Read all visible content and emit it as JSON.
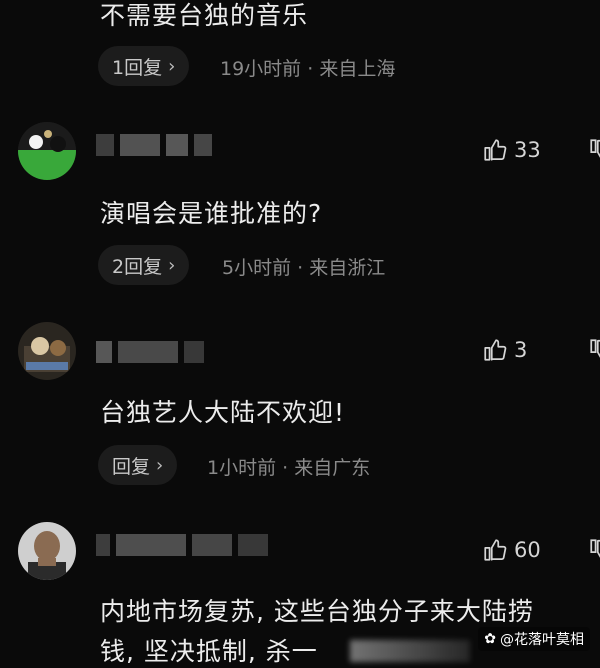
{
  "comments": [
    {
      "text": "不需要台独的音乐",
      "reply_label": "1回复",
      "time": "19小时前",
      "location": "来自上海"
    },
    {
      "likes": "33",
      "text": "演唱会是谁批准的?",
      "reply_label": "2回复",
      "time": "5小时前",
      "location": "来自浙江"
    },
    {
      "likes": "3",
      "text": "台独艺人大陆不欢迎!",
      "reply_label": "回复",
      "time": "1小时前",
      "location": "来自广东"
    },
    {
      "likes": "60",
      "text_line1": "内地市场复苏, 这些台独分子来大陆捞",
      "text_line2": "钱, 坚决抵制, 杀一"
    }
  ],
  "meta_separator": "·",
  "chevron": "›",
  "watermark": "@花落叶莫相",
  "colors": {
    "background": "#0a0a0a",
    "text": "#ececec",
    "meta": "#8a8a8a",
    "pill": "#1c1c1c"
  },
  "icons": [
    "thumbs-up-icon",
    "chevron-right-icon",
    "avatar-image"
  ]
}
